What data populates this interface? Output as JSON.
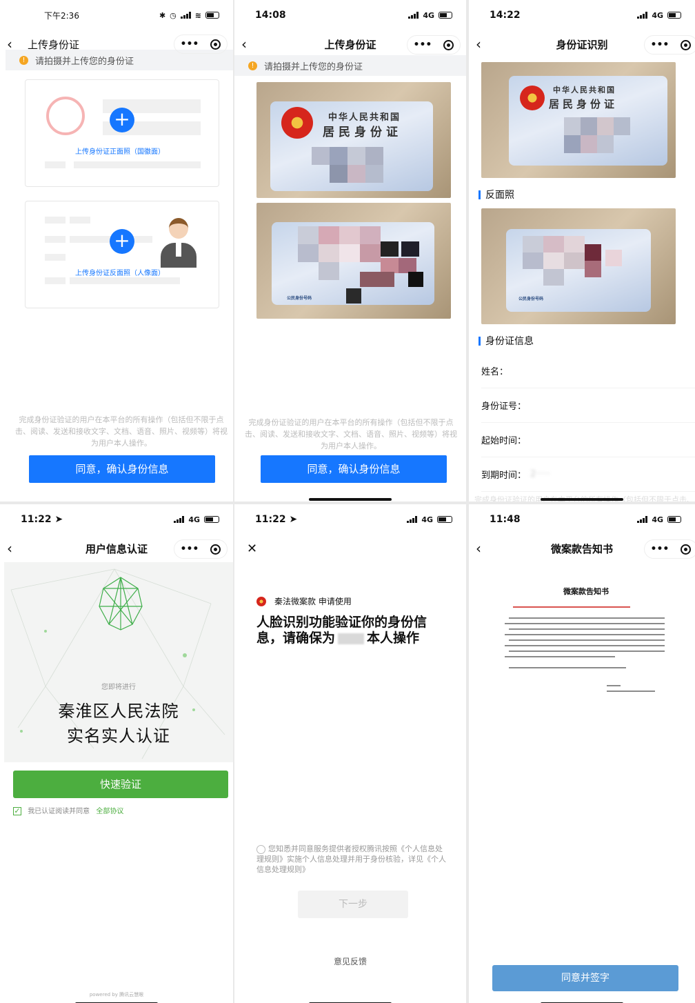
{
  "screen1": {
    "time": "下午2:36",
    "title": "上传身份证",
    "notice": "请拍摄并上传您的身份证",
    "front_label": "上传身份证正面照（国徽面）",
    "back_label": "上传身份证反面照（人像面）",
    "disclaimer": "完成身份证验证的用户在本平台的所有操作（包括但不限于点击、阅读、发送和接收文字、文档、语音、照片、视频等）将视为用户本人操作。",
    "button": "同意，确认身份信息"
  },
  "screen2": {
    "time": "14:08",
    "network": "4G",
    "title": "上传身份证",
    "notice": "请拍摄并上传您的身份证",
    "card_line1": "中华人民共和国",
    "card_line2": "居民身份证",
    "card_back_label": "公民身份号码",
    "disclaimer": "完成身份证验证的用户在本平台的所有操作（包括但不限于点击、阅读、发送和接收文字、文档、语音、照片、视频等）将视为用户本人操作。",
    "button": "同意，确认身份信息"
  },
  "screen3": {
    "time": "14:22",
    "network": "4G",
    "title": "身份证识别",
    "card_line1": "中华人民共和国",
    "card_line2": "居民身份证",
    "card_back_label": "公民身份号码",
    "back_section": "反面照",
    "info_section": "身份证信息",
    "fields": [
      "姓名：",
      "身份证号：",
      "起始时间：",
      "到期时间："
    ],
    "disclaimer": "完成身份证验证的用户在本平台的所有操作（包括但不限于点击、"
  },
  "screen4": {
    "time": "11:22",
    "network": "4G",
    "title": "用户信息认证",
    "intro": "您即将进行",
    "org_line1": "秦淮区人民法院",
    "org_line2": "实名实人认证",
    "button": "快速验证",
    "agree_text": "我已认证阅读并同意",
    "agree_link": "全部协议",
    "footer": "powered by 腾讯云慧眼"
  },
  "screen5": {
    "time": "11:22",
    "network": "4G",
    "applicant": "秦法微案款 申请使用",
    "heading": "人脸识别功能验证你的身份信息，请确保为",
    "heading_tail": "本人操作",
    "consent": "您知悉并同意服务提供者授权腾讯按照《个人信息处理规则》实施个人信息处理并用于身份核验，详见《个人信息处理规则》",
    "next": "下一步",
    "feedback": "意见反馈"
  },
  "screen6": {
    "time": "11:48",
    "network": "4G",
    "title": "微案款告知书",
    "doc_title": "微案款告知书",
    "button": "同意并签字"
  },
  "colors": {
    "primary_blue": "#1677ff",
    "green": "#4cae3f",
    "warning": "#f5a623"
  }
}
